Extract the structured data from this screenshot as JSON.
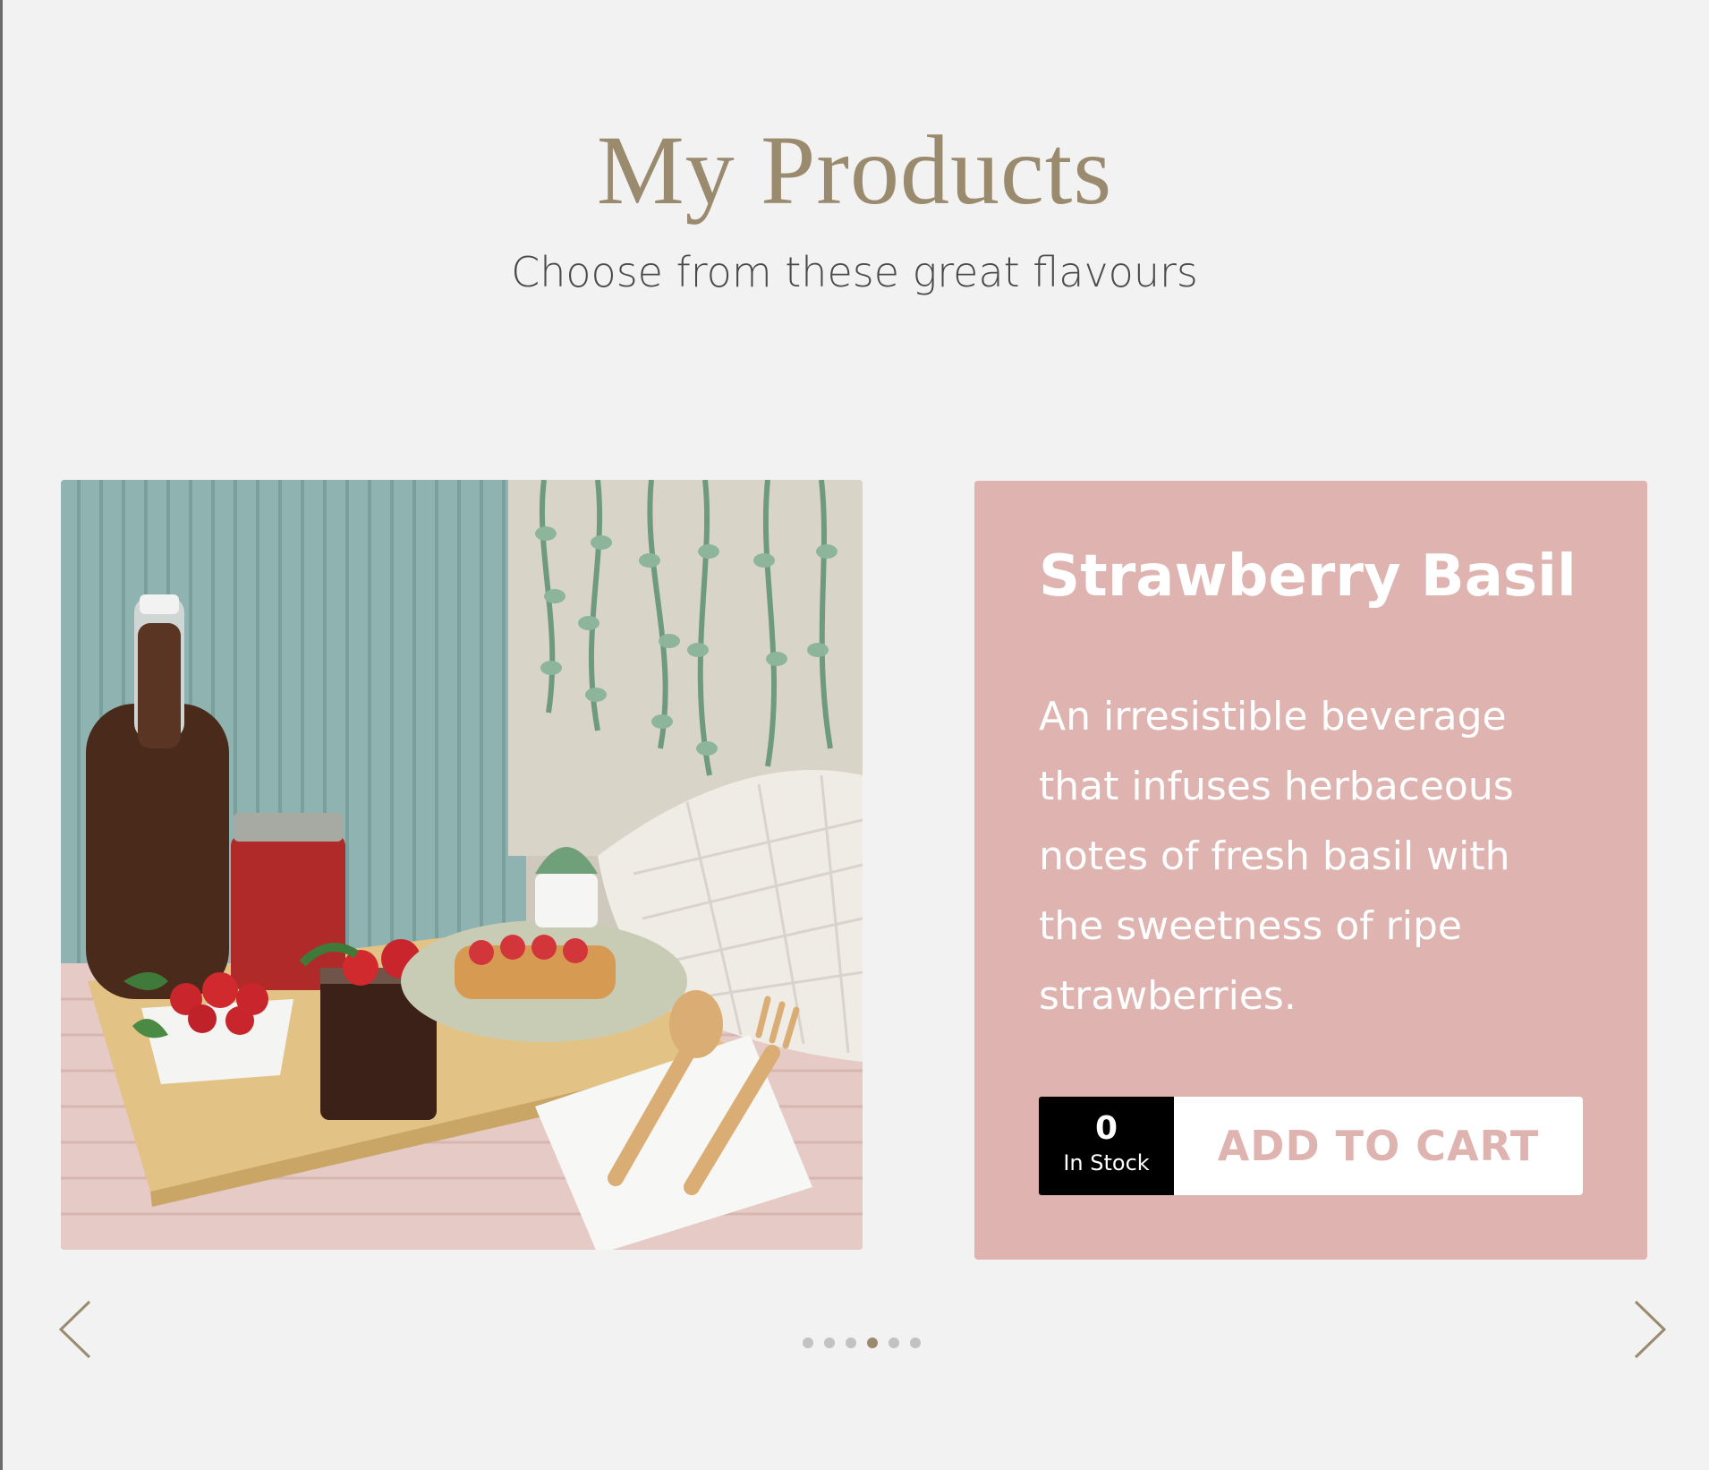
{
  "header": {
    "title": "My Products",
    "subtitle": "Choose from these great flavours"
  },
  "product": {
    "name": "Strawberry Basil",
    "description": "An irresistible beverage that infuses herbaceous notes of fresh basil with the sweetness of ripe strawberries.",
    "stock_count": "0",
    "stock_label": "In Stock",
    "cart_label": "ADD TO CART"
  },
  "carousel": {
    "slide_count": 6,
    "active_index": 3,
    "prev_icon": "chevron-left-icon",
    "next_icon": "chevron-right-icon"
  },
  "colors": {
    "accent": "#9a8a6e",
    "card": "#deb3b0",
    "background": "#f2f2f2"
  }
}
